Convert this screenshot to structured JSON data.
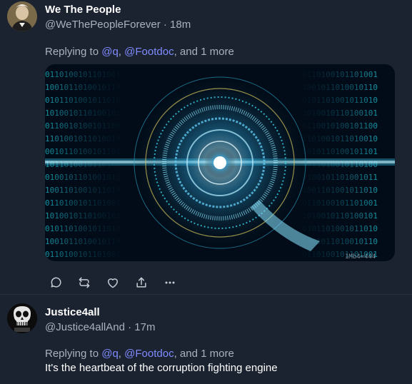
{
  "posts": [
    {
      "display_name": "We The People",
      "handle": "@WeThePeopleForever",
      "separator": " · ",
      "time": "18m",
      "replying_prefix": "Replying to ",
      "mention_1": "@q",
      "comma": ", ",
      "mention_2": "@Footdoc",
      "replying_suffix": ", and 1 more",
      "media_icon": "q-binary-tunnel-image",
      "media_watermark": "1Mb4=444"
    },
    {
      "display_name": "Justice4all",
      "handle": "@Justice4allAnd",
      "separator": " · ",
      "time": "17m",
      "replying_prefix": "Replying to ",
      "mention_1": "@q",
      "comma": ", ",
      "mention_2": "@Footdoc",
      "replying_suffix": ", and 1 more",
      "text": "It's the heartbeat of the corruption fighting engine"
    }
  ],
  "actions": {
    "icons": [
      "reply-icon",
      "repost-icon",
      "like-icon",
      "share-icon",
      "more-icon"
    ]
  },
  "colors": {
    "background": "#1b2230",
    "mention": "#7f8cff",
    "secondary_text": "#a9b1be",
    "primary_text": "#ffffff"
  }
}
